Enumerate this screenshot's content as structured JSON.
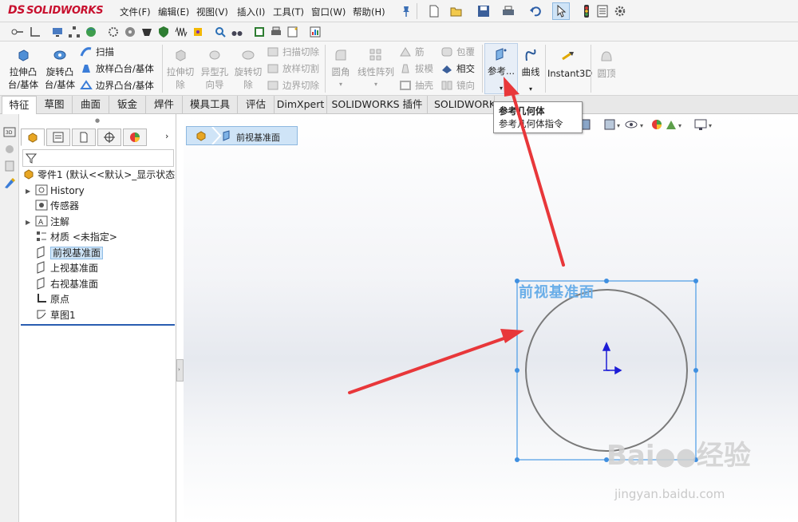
{
  "app": {
    "logo_text": "SOLIDWORKS",
    "logo_mark": "DS"
  },
  "menu": [
    "文件(F)",
    "编辑(E)",
    "视图(V)",
    "插入(I)",
    "工具(T)",
    "窗口(W)",
    "帮助(H)"
  ],
  "ribbon": {
    "extrude_boss": "拉伸凸\n台/基体",
    "revolve_boss": "旋转凸\n台/基体",
    "sweep": "扫描",
    "loft_boss": "放样凸台/基体",
    "boundary_boss": "边界凸台/基体",
    "extrude_cut": "拉伸切\n除",
    "hole_wizard": "异型孔\n向导",
    "revolve_cut": "旋转切\n除",
    "swept_cut": "扫描切除",
    "lofted_cut": "放样切割",
    "boundary_cut": "边界切除",
    "fillet": "圆角",
    "linear_pattern": "线性阵列",
    "rib": "筋",
    "draft": "拔模",
    "shell": "抽壳",
    "wrap": "包覆",
    "intersect": "相交",
    "mirror": "镜向",
    "reference_geometry": "参考...",
    "curves": "曲线",
    "instant3d": "Instant3D",
    "dome": "圆顶"
  },
  "tabs": [
    {
      "label": "特征",
      "active": true
    },
    {
      "label": "草图",
      "active": false
    },
    {
      "label": "曲面",
      "active": false
    },
    {
      "label": "钣金",
      "active": false
    },
    {
      "label": "焊件",
      "active": false
    },
    {
      "label": "模具工具",
      "active": false
    },
    {
      "label": "评估",
      "active": false
    },
    {
      "label": "DimXpert",
      "active": false
    },
    {
      "label": "SOLIDWORKS 插件",
      "active": false
    },
    {
      "label": "SOLIDWORKS",
      "active": false
    }
  ],
  "tooltip": {
    "title": "参考几何体",
    "description": "参考几何体指令"
  },
  "feature_tree": {
    "root": "零件1  (默认<<默认>_显示状态",
    "items": [
      {
        "label": "History",
        "expandable": true
      },
      {
        "label": "传感器",
        "expandable": false
      },
      {
        "label": "注解",
        "expandable": true
      },
      {
        "label": "材质 <未指定>",
        "expandable": false
      },
      {
        "label": "前视基准面",
        "expandable": false,
        "selected": true
      },
      {
        "label": "上视基准面",
        "expandable": false
      },
      {
        "label": "右视基准面",
        "expandable": false
      },
      {
        "label": "原点",
        "expandable": false
      },
      {
        "label": "草图1",
        "expandable": false
      }
    ]
  },
  "graphics": {
    "breadcrumb": "前视基准面",
    "plane_label": "前视基准面"
  },
  "watermark": {
    "brand": "Bai",
    "brand2": "经验",
    "url": "jingyan.baidu.com"
  },
  "colors": {
    "selection_blue": "#4a9be6",
    "plane_label": "#6aaee8",
    "arrow_red": "#e8373a",
    "logo_red": "#c8102e"
  }
}
